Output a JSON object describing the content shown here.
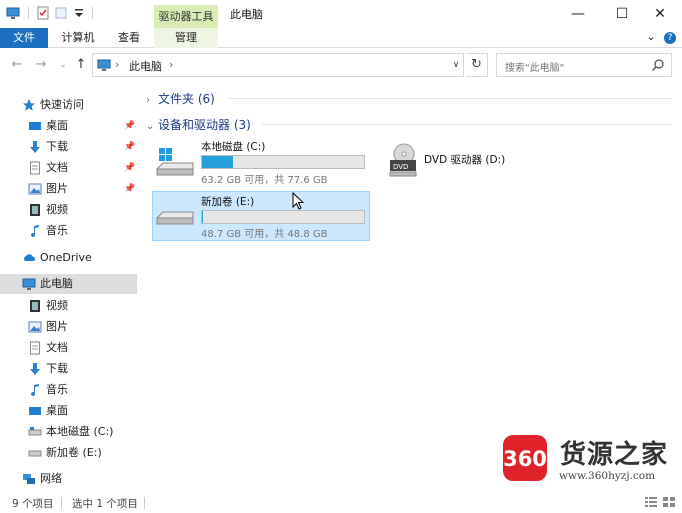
{
  "titlebar": {
    "context_tab": "驱动器工具",
    "window_title": "此电脑",
    "minimize": "—",
    "maximize": "☐",
    "close": "✕"
  },
  "ribbon": {
    "tabs": [
      "文件",
      "计算机",
      "查看",
      "管理"
    ],
    "collapse_glyph": "⌄",
    "help_glyph": "?"
  },
  "address": {
    "back": "←",
    "forward": "→",
    "up": "↑",
    "recent": "⌄",
    "separator": "›",
    "path": "此电脑",
    "path_end_separator": "›",
    "dropdown": "∨",
    "refresh": "↻",
    "search_placeholder": "搜索\"此电脑\""
  },
  "sidebar": {
    "quick_access": "快速访问",
    "quick_items": [
      "桌面",
      "下载",
      "文档",
      "图片",
      "视频",
      "音乐"
    ],
    "pinned_count": 4,
    "onedrive": "OneDrive",
    "this_pc": "此电脑",
    "pc_items": [
      "视频",
      "图片",
      "文档",
      "下载",
      "音乐",
      "桌面",
      "本地磁盘 (C:)",
      "新加卷 (E:)"
    ],
    "network": "网络"
  },
  "content": {
    "folders_header": "文件夹 (6)",
    "devices_header": "设备和驱动器 (3)",
    "drives": [
      {
        "name": "本地磁盘 (C:)",
        "info": "63.2 GB 可用，共 77.6 GB",
        "used_fraction": 0.19
      },
      {
        "name": "DVD 驱动器 (D:)",
        "info": "",
        "used_fraction": null
      },
      {
        "name": "新加卷 (E:)",
        "info": "48.7 GB 可用，共 48.8 GB",
        "used_fraction": 0.002
      }
    ]
  },
  "status": {
    "item_count": "9 个项目",
    "selected": "选中 1 个项目"
  },
  "watermark": {
    "logo_text": "360",
    "title": "货源之家",
    "url": "www.360hyzj.com"
  },
  "colors": {
    "accent": "#1a6fc1",
    "context_tab": "#d8ecb4",
    "drive_bar": "#26a0da",
    "selection": "#cce8ff",
    "watermark_red": "#e0232b"
  }
}
